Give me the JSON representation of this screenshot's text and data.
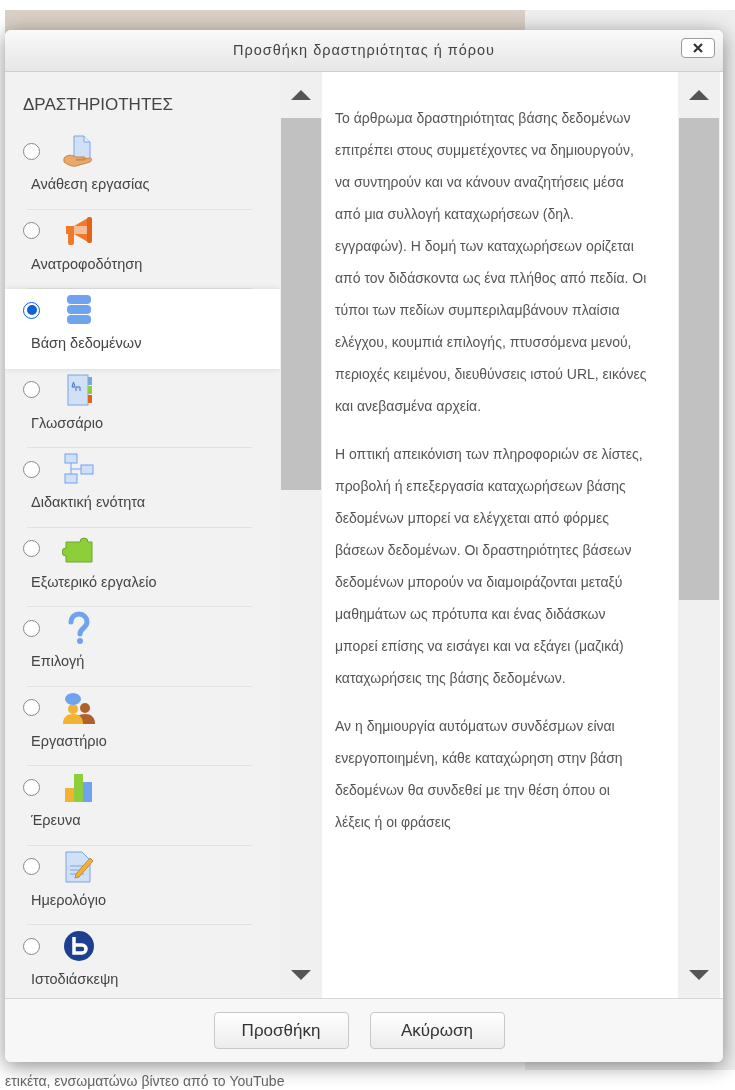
{
  "dialog": {
    "title": "Προσθήκη δραστηριότητας ή πόρου",
    "section_heading": "ΔΡΑΣΤΗΡΙΟΤΗΤΕΣ",
    "activities": [
      {
        "label": "Ανάθεση εργασίας",
        "selected": false
      },
      {
        "label": "Ανατροφοδότηση",
        "selected": false
      },
      {
        "label": "Βάση δεδομένων",
        "selected": true
      },
      {
        "label": "Γλωσσάριο",
        "selected": false
      },
      {
        "label": "Διδακτική ενότητα",
        "selected": false
      },
      {
        "label": "Εξωτερικό εργαλείο",
        "selected": false
      },
      {
        "label": "Επιλογή",
        "selected": false
      },
      {
        "label": "Εργαστήριο",
        "selected": false
      },
      {
        "label": "Έρευνα",
        "selected": false
      },
      {
        "label": "Ημερολόγιο",
        "selected": false
      },
      {
        "label": "Ιστοδιάσκεψη",
        "selected": false
      }
    ],
    "description": [
      "Το άρθρωμα δραστηριότητας βάσης δεδομένων επιτρέπει στους συμμετέχοντες να δημιουργούν, να συντηρούν και να κάνουν αναζητήσεις μέσα από μια συλλογή καταχωρήσεων (δηλ. εγγραφών). Η δομή των καταχωρήσεων ορίζεται από τον διδάσκοντα ως ένα πλήθος από πεδία. Οι τύποι των πεδίων συμπεριλαμβάνουν πλαίσια ελέγχου, κουμπιά επιλογής, πτυσσόμενα μενού, περιοχές κειμένου, διευθύνσεις ιστού URL, εικόνες και ανεβασμένα αρχεία.",
      "Η οπτική απεικόνιση των πληροφοριών σε λίστες, προβολή ή επεξεργασία καταχωρήσεων βάσης δεδομένων μπορεί να ελέγχεται από φόρμες βάσεων δεδομένων. Οι δραστηριότητες βάσεων δεδομένων μπορούν να διαμοιράζονται μεταξύ μαθημάτων ως πρότυπα και ένας διδάσκων μπορεί επίσης να εισάγει και να εξάγει (μαζικά) καταχωρήσεις της βάσης δεδομένων.",
      "Αν η δημιουργία αυτόματων συνδέσμων είναι ενεργοποιημένη, κάθε καταχώρηση στην βάση δεδομένων θα συνδεθεί με την θέση όπου οι λέξεις ή οι φράσεις"
    ],
    "buttons": [
      {
        "label": "Προσθήκη"
      },
      {
        "label": "Ακύρωση"
      }
    ]
  },
  "background_text": "ετικέτα, ενσωματώνω βίντεο από το YouTube"
}
